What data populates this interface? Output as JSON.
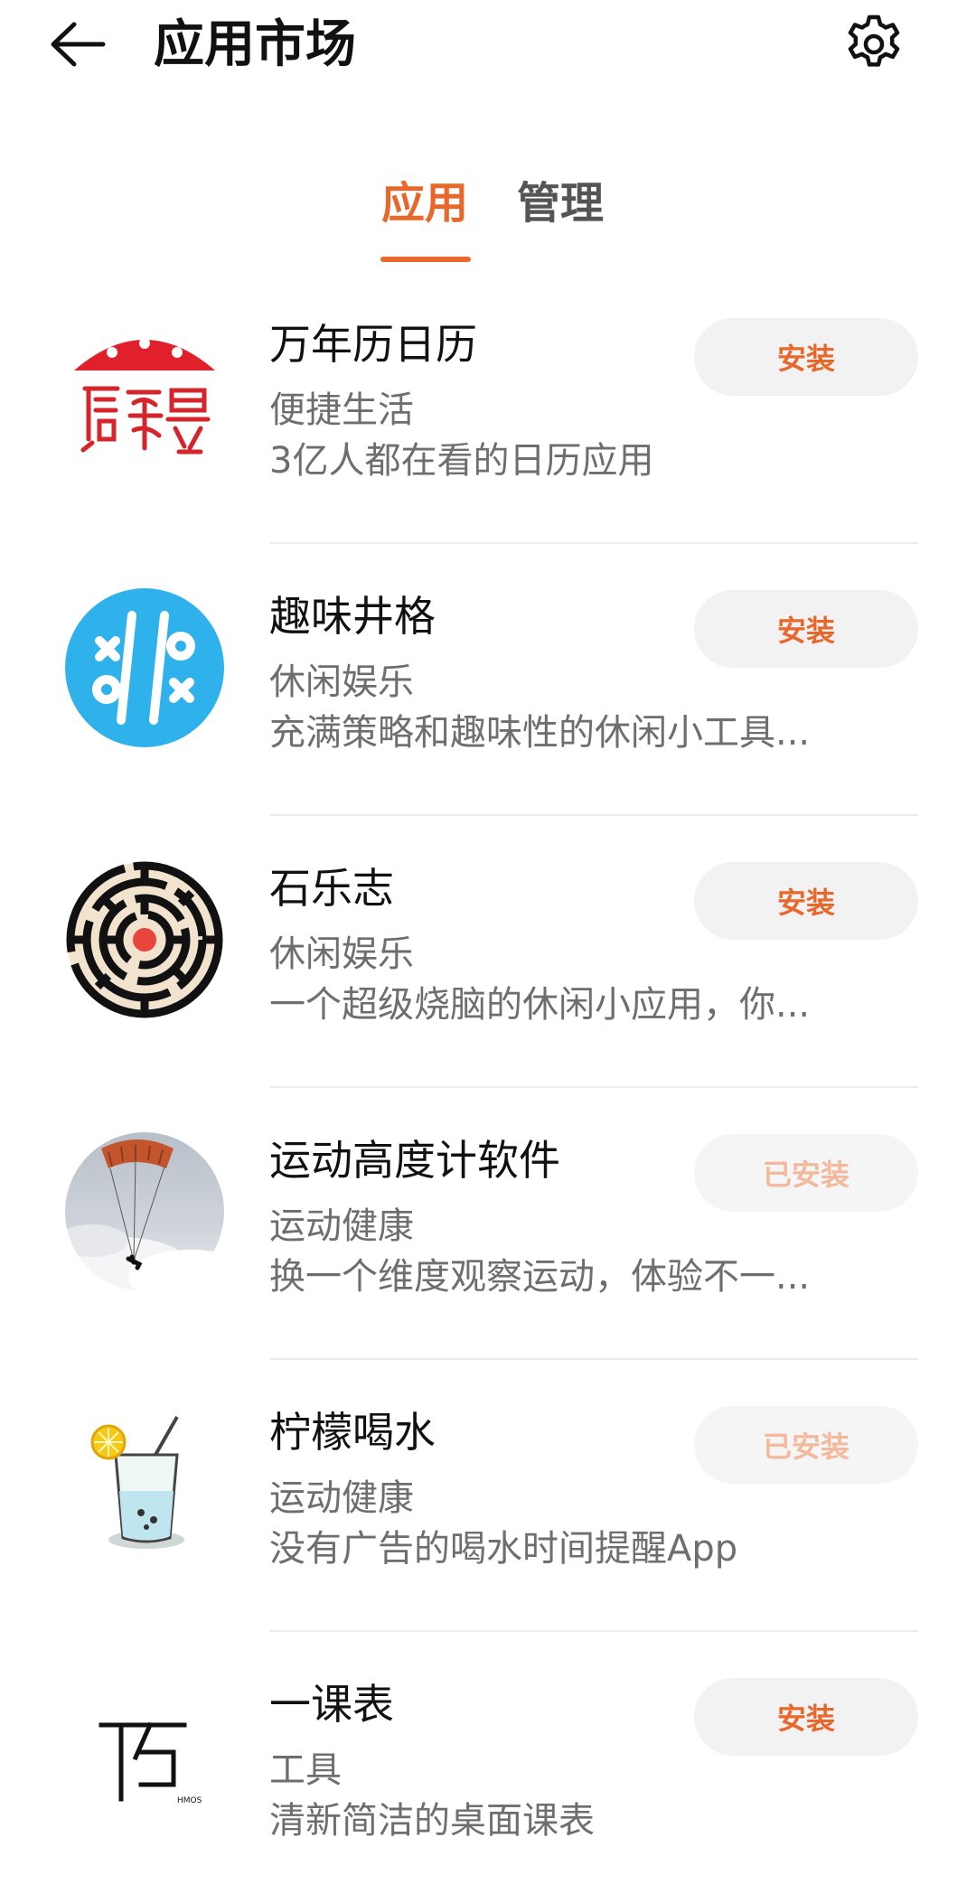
{
  "header": {
    "title": "应用市场",
    "back_icon": "arrow-left-icon",
    "settings_icon": "gear-icon"
  },
  "tabs": [
    {
      "label": "应用",
      "active": true
    },
    {
      "label": "管理",
      "active": false
    }
  ],
  "colors": {
    "accent": "#e8682b",
    "installed_text": "#f3b99c",
    "button_bg": "#f2f2f2",
    "secondary_text": "#6e6e6e"
  },
  "apps": [
    {
      "name": "万年历日历",
      "category": "便捷生活",
      "description": "3亿人都在看的日历应用",
      "action": "安装",
      "installed": false,
      "icon": "calendar-seal-icon"
    },
    {
      "name": "趣味井格",
      "category": "休闲娱乐",
      "description": "充满策略和趣味性的休闲小工具...",
      "action": "安装",
      "installed": false,
      "icon": "tic-tac-toe-icon"
    },
    {
      "name": "石乐志",
      "category": "休闲娱乐",
      "description": "一个超级烧脑的休闲小应用，你...",
      "action": "安装",
      "installed": false,
      "icon": "maze-icon"
    },
    {
      "name": "运动高度计软件",
      "category": "运动健康",
      "description": "换一个维度观察运动，体验不一...",
      "action": "已安装",
      "installed": true,
      "icon": "paraglider-icon"
    },
    {
      "name": "柠檬喝水",
      "category": "运动健康",
      "description": "没有广告的喝水时间提醒App",
      "action": "已安装",
      "installed": true,
      "icon": "lemon-water-glass-icon"
    },
    {
      "name": "一课表",
      "category": "工具",
      "description": "清新简洁的桌面课表",
      "action": "安装",
      "installed": false,
      "icon": "course-table-logo-icon",
      "icon_text": "HMOS"
    }
  ]
}
